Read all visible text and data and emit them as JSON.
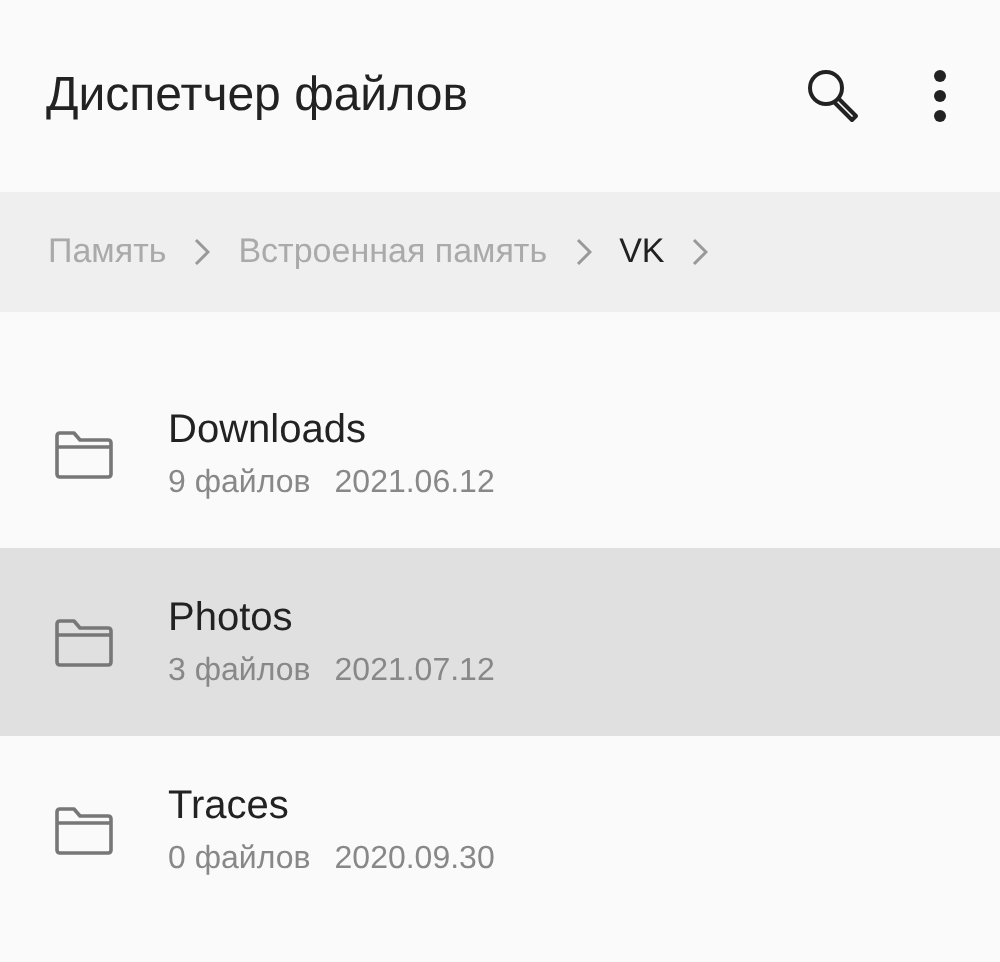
{
  "header": {
    "title": "Диспетчер файлов"
  },
  "breadcrumb": [
    {
      "label": "Память",
      "selected": false
    },
    {
      "label": "Встроенная память",
      "selected": false
    },
    {
      "label": "VK",
      "selected": true
    }
  ],
  "folders": [
    {
      "name": "Downloads",
      "count": "9 файлов",
      "date": "2021.06.12",
      "selected": false
    },
    {
      "name": "Photos",
      "count": "3 файлов",
      "date": "2021.07.12",
      "selected": true
    },
    {
      "name": "Traces",
      "count": "0 файлов",
      "date": "2020.09.30",
      "selected": false
    }
  ]
}
